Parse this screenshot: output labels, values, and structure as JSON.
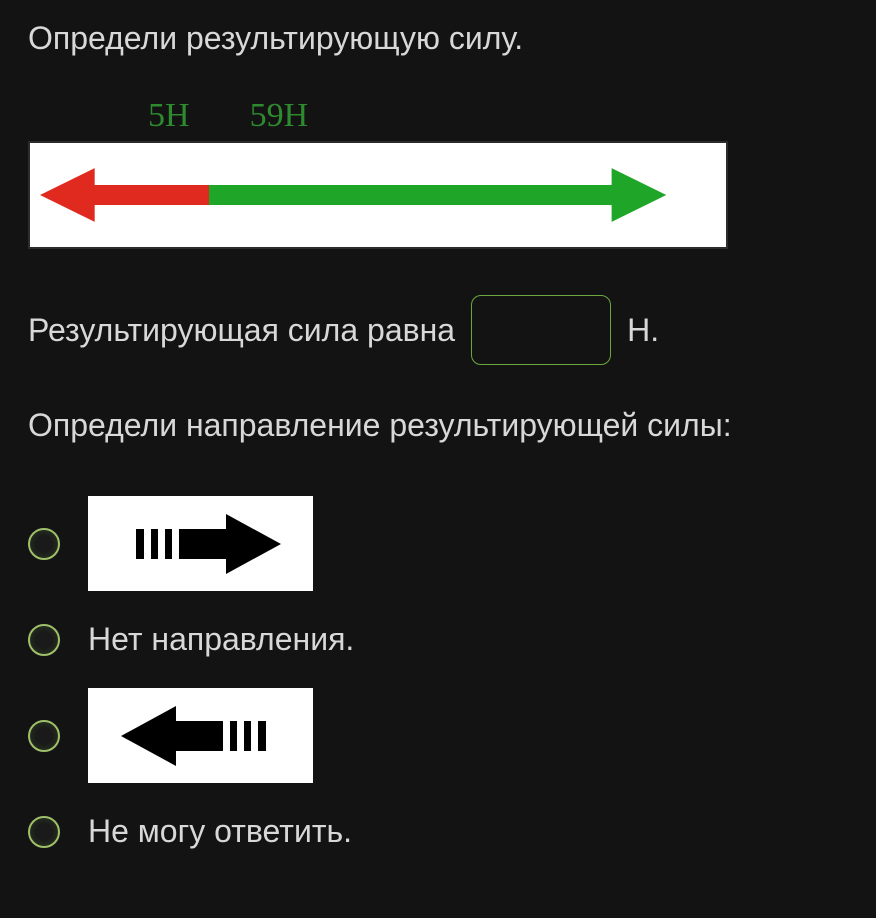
{
  "question": {
    "prompt": "Определи результирующую силу.",
    "forces": {
      "left_label": "5Н",
      "right_label": "59Н",
      "left_value": 5,
      "right_value": 59,
      "left_color": "#e12a1f",
      "right_color": "#1fa527"
    },
    "answer_label_before": "Результирующая сила равна",
    "answer_unit": "Н.",
    "answer_value": "",
    "direction_prompt": "Определи направление результирующей силы:",
    "options": [
      {
        "id": "right",
        "type": "arrow-right"
      },
      {
        "id": "none",
        "type": "text",
        "label": "Нет направления."
      },
      {
        "id": "left",
        "type": "arrow-left"
      },
      {
        "id": "dunno",
        "type": "text",
        "label": "Не могу ответить."
      }
    ]
  }
}
